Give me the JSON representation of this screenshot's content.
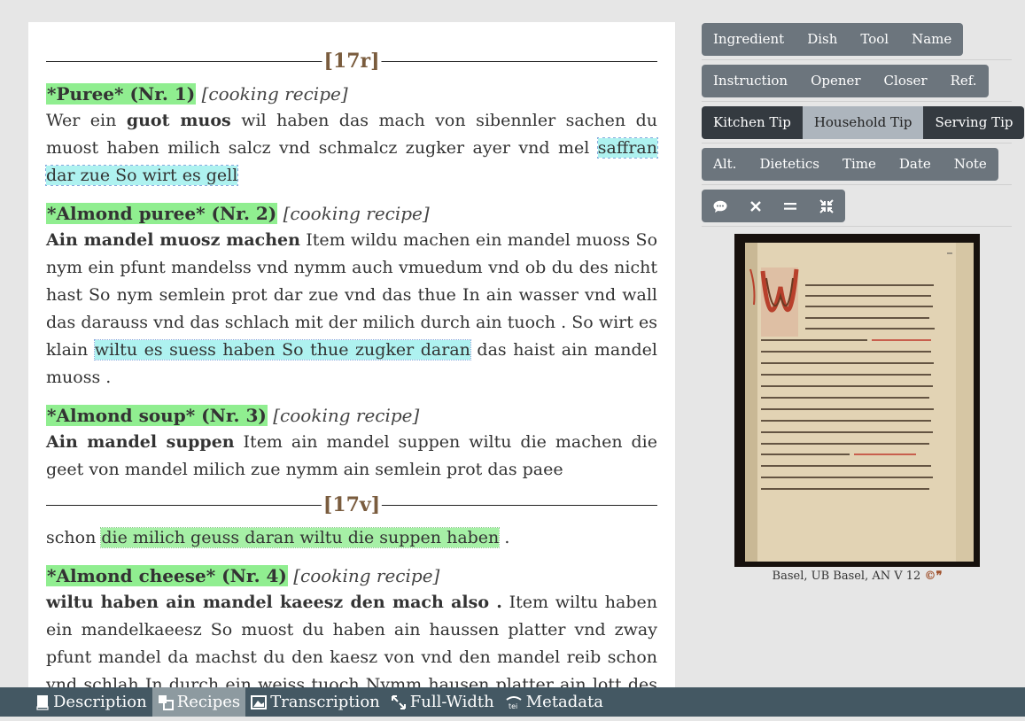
{
  "text": {
    "folio_1": "[17r]",
    "folio_2": "[17v]",
    "recipes": [
      {
        "title": "*Puree* (Nr. 1)",
        "type": "[cooking recipe]",
        "lead_plain": "Wer ein ",
        "lead_bold": "guot muos",
        "body": " wil haben das mach von sibennler sachen du muost haben milich salcz vnd schmalcz zugker ayer vnd mel ",
        "highlight": "saffran dar zue So wirt es gell",
        "tail": ""
      },
      {
        "title": "*Almond puree* (Nr. 2)",
        "type": "[cooking recipe]",
        "lead_bold": "Ain mandel muosz machen",
        "body": " Item wildu machen ein mandel muoss So nym ein pfunt mandelss vnd nymm auch vmuedum vnd ob du des nicht hast So nym semlein prot dar zue vnd das thue In ain wasser vnd wall das darauss vnd das schlach mit der milich durch ain tuoch . So wirt es klain ",
        "highlight": "wiltu es suess haben So thue zugker daran",
        "tail": " das haist ain mandel muoss ."
      },
      {
        "title": "*Almond soup* (Nr. 3)",
        "type": "[cooking recipe]",
        "lead_bold": "Ain mandel suppen",
        "body": " Item ain mandel suppen wiltu die machen die geet von mandel milich zue nymm ain semlein prot das paee"
      },
      {
        "continuation_plain": "schon ",
        "continuation_highlight": "die milich geuss daran wiltu die suppen haben",
        "continuation_tail": " ."
      },
      {
        "title": "*Almond cheese* (Nr. 4)",
        "type": "[cooking recipe]",
        "lead_bold": "wiltu haben ain mandel kaeesz den mach also .",
        "body": " Item wiltu haben ein mandelkaeesz So muost du haben ain haussen platter vnd zway pfunt mandel da machst du den kaesz von vnd den mandel reib schon vnd schlah In durch ein weiss tuoch Nymm hausen platter ain lott des ist Im not die"
      }
    ]
  },
  "filters": {
    "row1": [
      "Ingredient",
      "Dish",
      "Tool",
      "Name"
    ],
    "row2": [
      "Instruction",
      "Opener",
      "Closer",
      "Ref."
    ],
    "row3": [
      "Kitchen Tip",
      "Household Tip",
      "Serving Tip"
    ],
    "row4": [
      "Alt.",
      "Dietetics",
      "Time",
      "Date",
      "Note"
    ],
    "row5_icons": [
      "comment-icon",
      "close-icon",
      "equals-icon",
      "compress-icon"
    ]
  },
  "image": {
    "caption": "Basel, UB Basel, AN V 12"
  },
  "toolbar": {
    "description": "Description",
    "recipes": "Recipes",
    "transcription": "Transcription",
    "full_width": "Full-Width",
    "metadata": "Metadata"
  },
  "colors": {
    "title_highlight": "#90ee90",
    "cyan_highlight": "#aef2f0",
    "folio": "#7a5c3e",
    "button": "#6c757d",
    "button_dark": "#343a40",
    "toolbar": "#445863"
  }
}
